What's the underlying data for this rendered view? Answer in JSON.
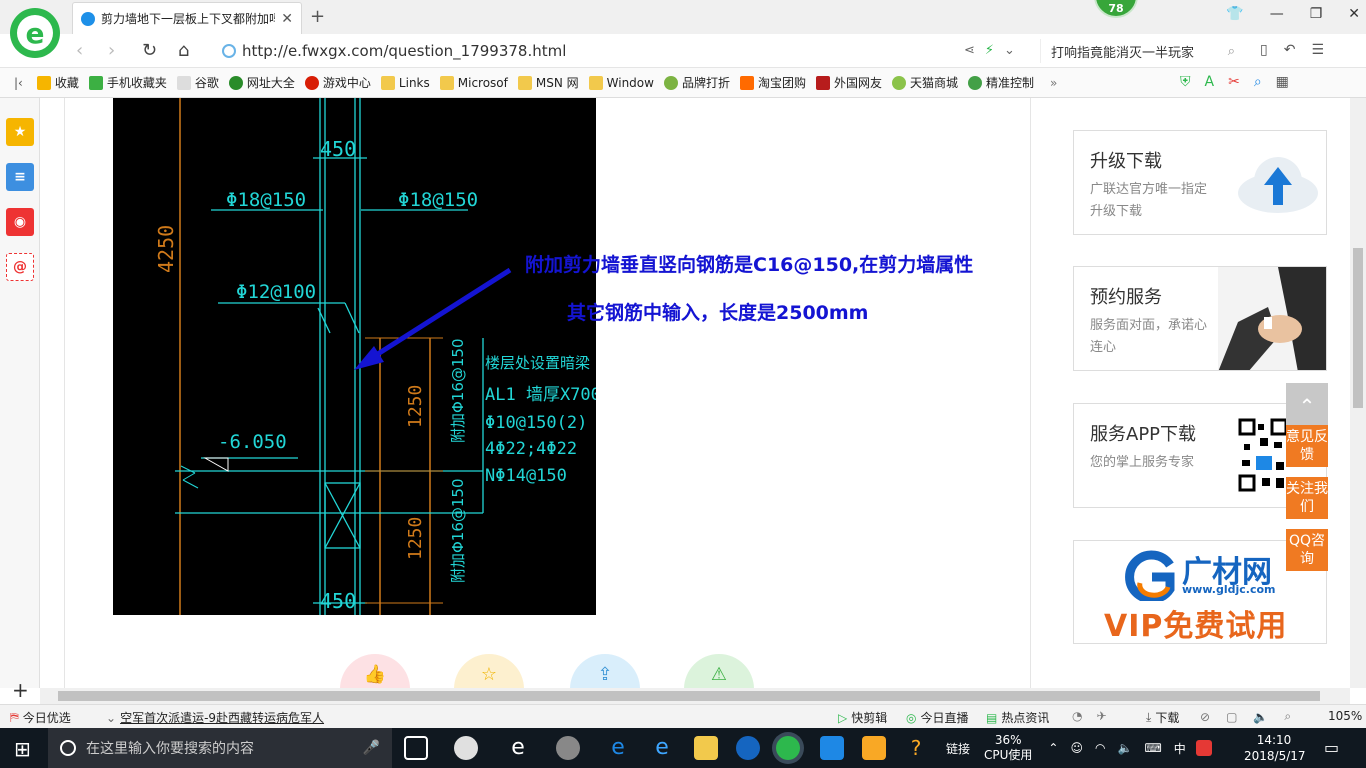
{
  "browser": {
    "tab_title": "剪力墙地下一层板上下叉都附加吗",
    "url": "http://e.fwxgx.com/question_1799378.html",
    "search_text": "打响指竟能消灭一半玩家",
    "badge_count": "78",
    "logo_letter": "e"
  },
  "bookmarks": [
    {
      "label": "收藏",
      "color": "#f6b500"
    },
    {
      "label": "手机收藏夹",
      "color": "#3cb043"
    },
    {
      "label": "谷歌",
      "color": "#bbbbbb"
    },
    {
      "label": "网址大全",
      "color": "#2a8c2a"
    },
    {
      "label": "游戏中心",
      "color": "#d81e06"
    },
    {
      "label": "Links",
      "color": "#f2c94c"
    },
    {
      "label": "Microsof",
      "color": "#f2c94c"
    },
    {
      "label": "MSN 网",
      "color": "#f2c94c"
    },
    {
      "label": "Window",
      "color": "#f2c94c"
    },
    {
      "label": "品牌打折",
      "color": "#7cb342"
    },
    {
      "label": "淘宝团购",
      "color": "#ff6a00"
    },
    {
      "label": "外国网友",
      "color": "#b71c1c"
    },
    {
      "label": "天猫商城",
      "color": "#8bc34a"
    },
    {
      "label": "精准控制",
      "color": "#43a047"
    }
  ],
  "sidebar_icons": [
    "star-icon",
    "list-icon",
    "weibo-icon",
    "mail-icon"
  ],
  "cad_drawing": {
    "dim_450_top": "450",
    "rebar_left": "Φ18@150",
    "rebar_right": "Φ18@150",
    "height_4250": "4250",
    "rebar_mid": "Φ12@100",
    "beam_title": "楼层处设置暗梁",
    "beam_l1": "AL1 墙厚X700",
    "beam_l2": "Φ10@150(2)",
    "beam_l3": "4Φ22;4Φ22",
    "beam_l4": "NΦ14@150",
    "dim_1250_a": "1250",
    "dim_1250_b": "1250",
    "vert_rebar_a": "附加Φ16@150",
    "vert_rebar_b": "附加Φ16@150",
    "elev": "-6.050",
    "dim_450_bottom": "450"
  },
  "annotation": {
    "line1": "附加剪力墙垂直竖向钢筋是C16@150,在剪力墙属性",
    "line2": "其它钢筋中输入，长度是2500mm"
  },
  "cards": [
    {
      "title": "升级下载",
      "sub": "广联达官方唯一指定升级下载"
    },
    {
      "title": "预约服务",
      "sub": "服务面对面，承诺心连心"
    },
    {
      "title": "服务APP下载",
      "sub": "您的掌上服务专家"
    }
  ],
  "glodon_ad": {
    "brand": "广材网",
    "domain": "www.gldjc.com",
    "promo": "VIP免费试用"
  },
  "float_buttons": [
    "意见反馈",
    "关注我们",
    "QQ咨询"
  ],
  "statusbar": {
    "today": "今日优选",
    "news": "空军首次派遣运-9赴西藏转运病危军人",
    "kuaijian": "快剪辑",
    "live": "今日直播",
    "hot": "热点资讯",
    "download": "下载",
    "zoom": "105%"
  },
  "taskbar": {
    "search_placeholder": "在这里输入你要搜索的内容",
    "link": "链接",
    "cpu_pct": "36%",
    "cpu_label": "CPU使用",
    "ime": "中",
    "time": "14:10",
    "date": "2018/5/17"
  }
}
